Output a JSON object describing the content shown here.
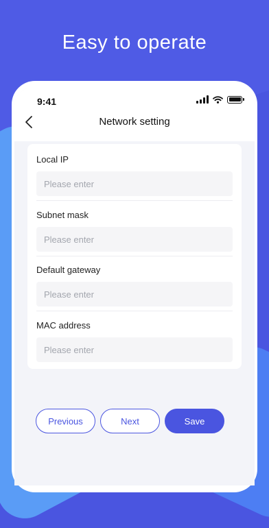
{
  "headline": "Easy to operate",
  "status_bar": {
    "time": "9:41"
  },
  "nav": {
    "title": "Network setting",
    "back_icon": "chevron-left-icon"
  },
  "form": {
    "fields": [
      {
        "label": "Local IP",
        "placeholder": "Please enter",
        "value": ""
      },
      {
        "label": "Subnet mask",
        "placeholder": "Please enter",
        "value": ""
      },
      {
        "label": "Default gateway",
        "placeholder": "Please enter",
        "value": ""
      },
      {
        "label": "MAC address",
        "placeholder": "Please enter",
        "value": ""
      }
    ]
  },
  "buttons": {
    "previous": "Previous",
    "next": "Next",
    "save": "Save"
  },
  "colors": {
    "accent": "#4a55e0",
    "background": "#4a55e0",
    "accent_light": "#5a9cf6"
  }
}
